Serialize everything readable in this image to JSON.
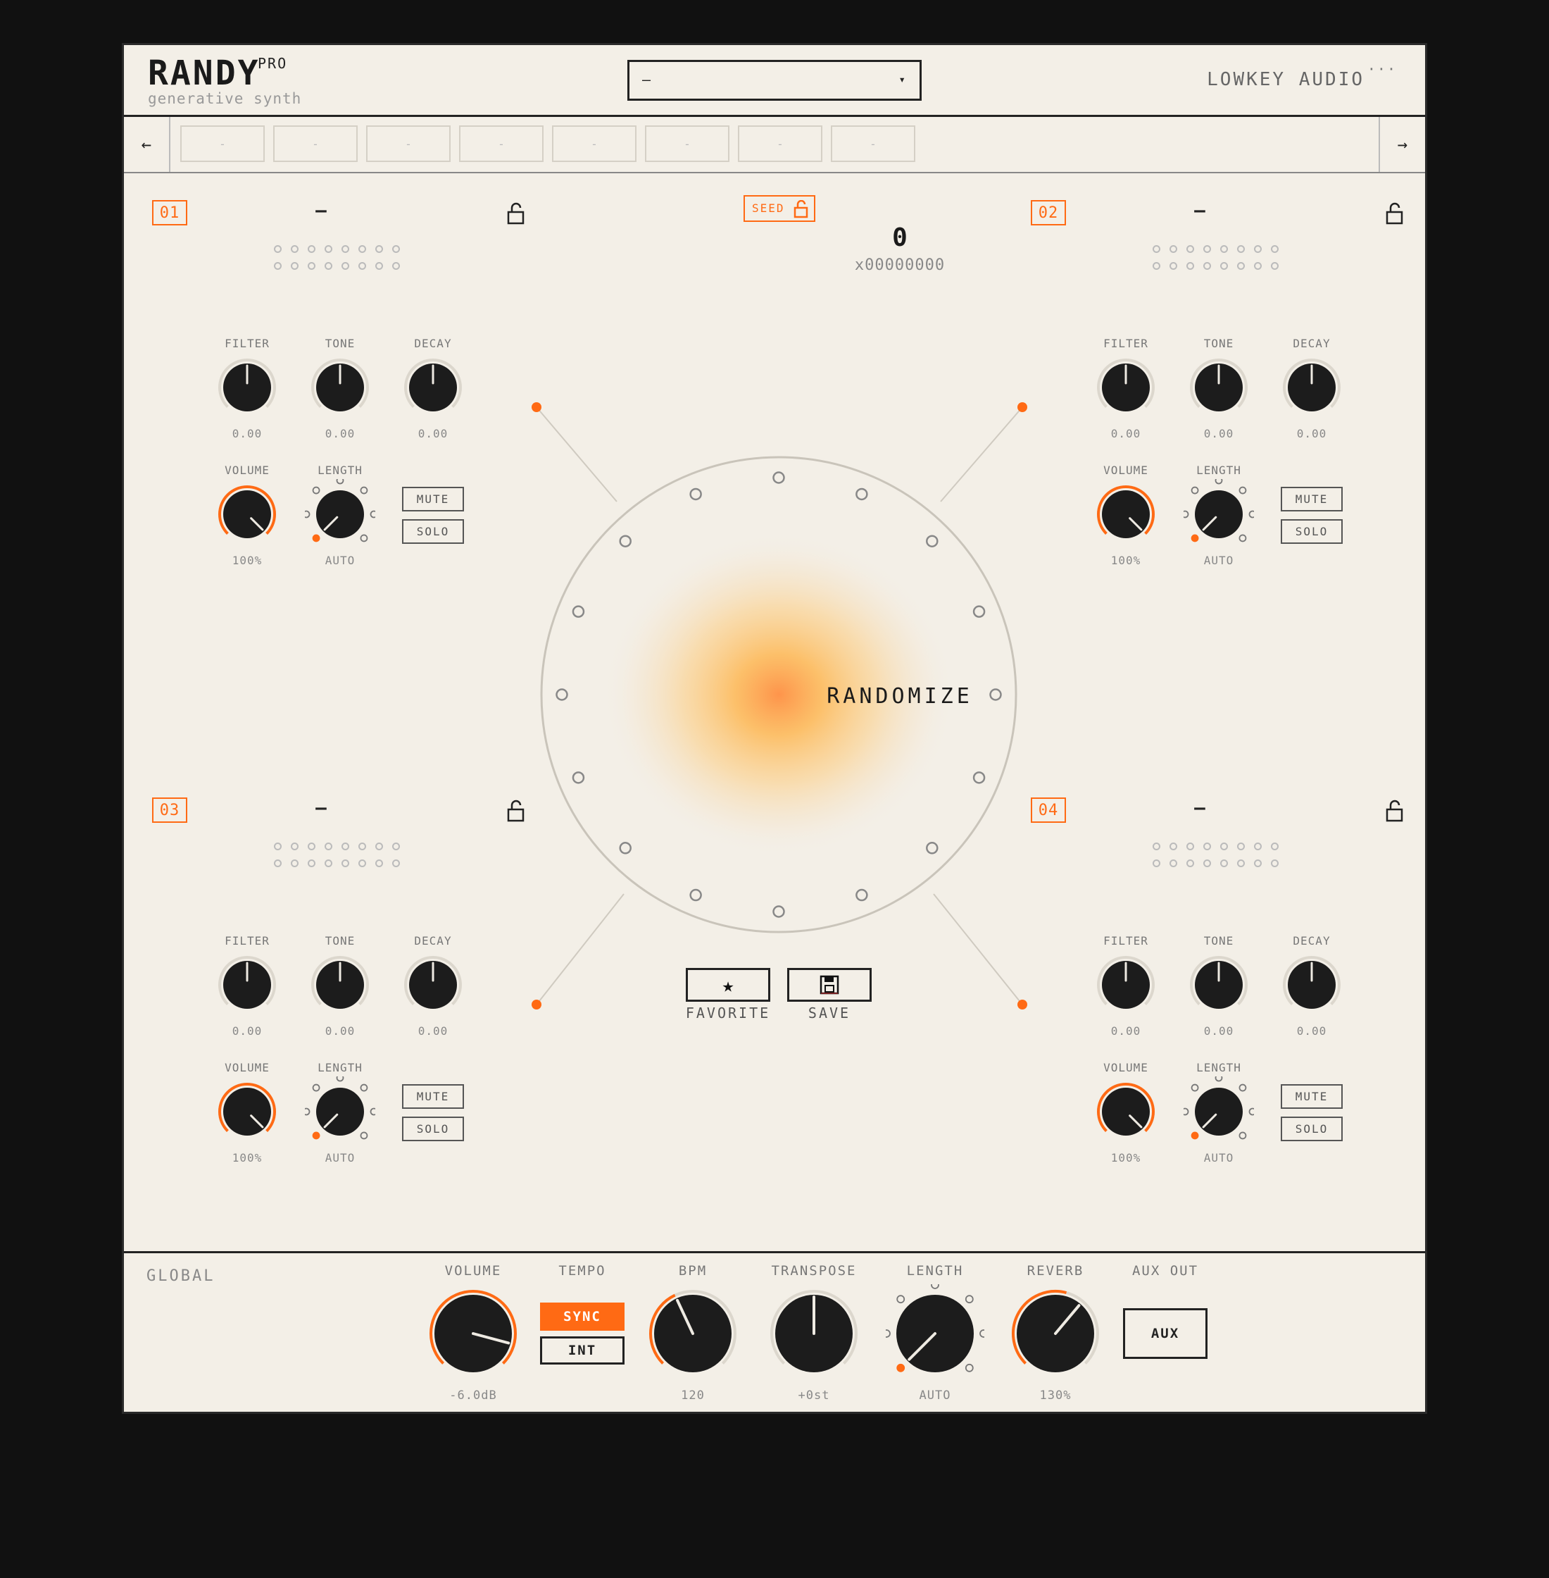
{
  "header": {
    "brand": "RANDY",
    "brand_badge": "PRO",
    "subtitle": "generative synth",
    "preset_value": "–",
    "preset_caret": "▾",
    "vendor": "LOWKEY AUDIO",
    "vendor_more": "···"
  },
  "slotbar": {
    "prev": "←",
    "next": "→",
    "slots": [
      "-",
      "-",
      "-",
      "-",
      "-",
      "-",
      "-",
      "-"
    ]
  },
  "channels": [
    {
      "number": "01",
      "name": "–",
      "knobs": {
        "filter_label": "FILTER",
        "filter_value": "0.00",
        "tone_label": "TONE",
        "tone_value": "0.00",
        "decay_label": "DECAY",
        "decay_value": "0.00",
        "volume_label": "VOLUME",
        "volume_value": "100%",
        "length_label": "LENGTH",
        "length_value": "AUTO"
      },
      "mute": "MUTE",
      "solo": "SOLO"
    },
    {
      "number": "02",
      "name": "–",
      "knobs": {
        "filter_label": "FILTER",
        "filter_value": "0.00",
        "tone_label": "TONE",
        "tone_value": "0.00",
        "decay_label": "DECAY",
        "decay_value": "0.00",
        "volume_label": "VOLUME",
        "volume_value": "100%",
        "length_label": "LENGTH",
        "length_value": "AUTO"
      },
      "mute": "MUTE",
      "solo": "SOLO"
    },
    {
      "number": "03",
      "name": "–",
      "knobs": {
        "filter_label": "FILTER",
        "filter_value": "0.00",
        "tone_label": "TONE",
        "tone_value": "0.00",
        "decay_label": "DECAY",
        "decay_value": "0.00",
        "volume_label": "VOLUME",
        "volume_value": "100%",
        "length_label": "LENGTH",
        "length_value": "AUTO"
      },
      "mute": "MUTE",
      "solo": "SOLO"
    },
    {
      "number": "04",
      "name": "–",
      "knobs": {
        "filter_label": "FILTER",
        "filter_value": "0.00",
        "tone_label": "TONE",
        "tone_value": "0.00",
        "decay_label": "DECAY",
        "decay_value": "0.00",
        "volume_label": "VOLUME",
        "volume_value": "100%",
        "length_label": "LENGTH",
        "length_value": "AUTO"
      },
      "mute": "MUTE",
      "solo": "SOLO"
    }
  ],
  "center": {
    "seed_label": "SEED",
    "seed_value": "0",
    "seed_hex": "x00000000",
    "randomize": "RANDOMIZE",
    "favorite_label": "FAVORITE",
    "save_label": "SAVE",
    "favorite_icon": "star-icon",
    "save_icon": "floppy-disk-icon"
  },
  "global": {
    "label": "GLOBAL",
    "volume_label": "VOLUME",
    "volume_value": "-6.0dB",
    "tempo_label": "TEMPO",
    "sync": "SYNC",
    "int": "INT",
    "bpm_label": "BPM",
    "bpm_value": "120",
    "transpose_label": "TRANSPOSE",
    "transpose_value": "+0st",
    "length_label": "LENGTH",
    "length_value": "AUTO",
    "reverb_label": "REVERB",
    "reverb_value": "130%",
    "aux_label": "AUX OUT",
    "aux_button": "AUX"
  },
  "colors": {
    "accent": "#ff6a14",
    "background": "#f3efe7",
    "frame": "#111111",
    "knob": "#1c1c1c"
  }
}
